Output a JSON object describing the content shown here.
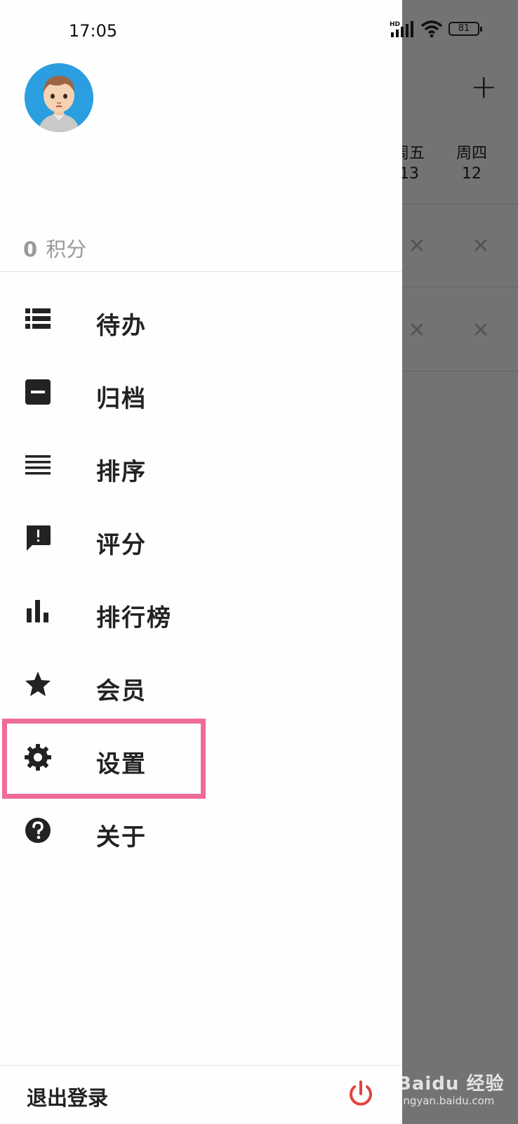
{
  "status_bar": {
    "time": "17:05",
    "battery": "81",
    "network_label": "HD"
  },
  "background_app": {
    "add_symbol": "+",
    "days": [
      {
        "name": "周五",
        "num": "13"
      },
      {
        "name": "周四",
        "num": "12"
      }
    ]
  },
  "drawer": {
    "points_value": "0",
    "points_label": "积分",
    "menu": [
      {
        "label": "待办",
        "icon": "list-icon"
      },
      {
        "label": "归档",
        "icon": "archive-icon"
      },
      {
        "label": "排序",
        "icon": "sort-icon"
      },
      {
        "label": "评分",
        "icon": "feedback-icon"
      },
      {
        "label": "排行榜",
        "icon": "bar-chart-icon"
      },
      {
        "label": "会员",
        "icon": "star-icon"
      },
      {
        "label": "设置",
        "icon": "gear-icon"
      },
      {
        "label": "关于",
        "icon": "help-icon"
      }
    ],
    "logout_label": "退出登录"
  },
  "colors": {
    "highlight": "#f06b97",
    "power": "#e0443c",
    "avatar_bg": "#2a9ee0"
  },
  "watermark": {
    "text": "Baidu 经验",
    "sub": "jingyan.baidu.com"
  }
}
